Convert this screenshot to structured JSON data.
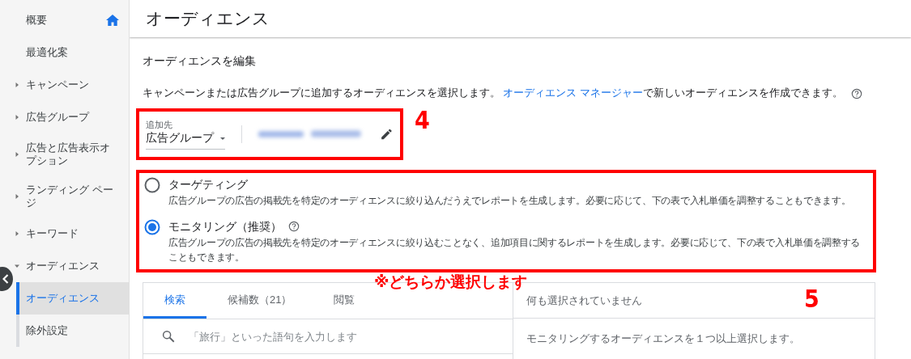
{
  "sidebar": {
    "items": [
      {
        "label": "概要",
        "kind": "home"
      },
      {
        "label": "最適化案",
        "kind": "plain"
      },
      {
        "label": "キャンペーン",
        "kind": "expandable",
        "expanded": false
      },
      {
        "label": "広告グループ",
        "kind": "expandable",
        "expanded": false
      },
      {
        "label": "広告と広告表示オプション",
        "kind": "expandable",
        "expanded": false
      },
      {
        "label": "ランディング ページ",
        "kind": "expandable",
        "expanded": false
      },
      {
        "label": "キーワード",
        "kind": "expandable",
        "expanded": false
      },
      {
        "label": "オーディエンス",
        "kind": "expandable",
        "expanded": true,
        "children": [
          {
            "label": "オーディエンス",
            "selected": true
          },
          {
            "label": "除外設定",
            "selected": false
          }
        ]
      }
    ]
  },
  "page": {
    "title": "オーディエンス"
  },
  "editor": {
    "heading": "オーディエンスを編集",
    "description": "キャンペーンまたは広告グループに追加するオーディエンスを選択します。",
    "link": "オーディエンス マネージャー",
    "description_after": "で新しいオーディエンスを作成できます。",
    "add_to": {
      "label": "追加先",
      "value": "広告グループ"
    },
    "options": [
      {
        "label": "ターゲティング",
        "description": "広告グループの広告の掲載先を特定のオーディエンスに絞り込んだうえでレポートを生成します。必要に応じて、下の表で入札単価を調整することもできます。",
        "selected": false,
        "help": false
      },
      {
        "label": "モニタリング（推奨）",
        "description": "広告グループの広告の掲載先を特定のオーディエンスに絞り込むことなく、追加項目に関するレポートを生成します。必要に応じて、下の表で入札単価を調整することもできます。",
        "selected": true,
        "help": true
      }
    ],
    "tabs": [
      {
        "label": "検索",
        "selected": true
      },
      {
        "label": "候補数（21）",
        "selected": false
      },
      {
        "label": "閲覧",
        "selected": false
      }
    ],
    "search": {
      "placeholder": "「旅行」といった語句を入力します"
    },
    "selection": {
      "status": "何も選択されていません",
      "hint": "モニタリングするオーディエンスを１つ以上選択します。"
    }
  },
  "annotations": {
    "step_a": "4",
    "note": "※どちらか選択します",
    "step_b": "5"
  }
}
